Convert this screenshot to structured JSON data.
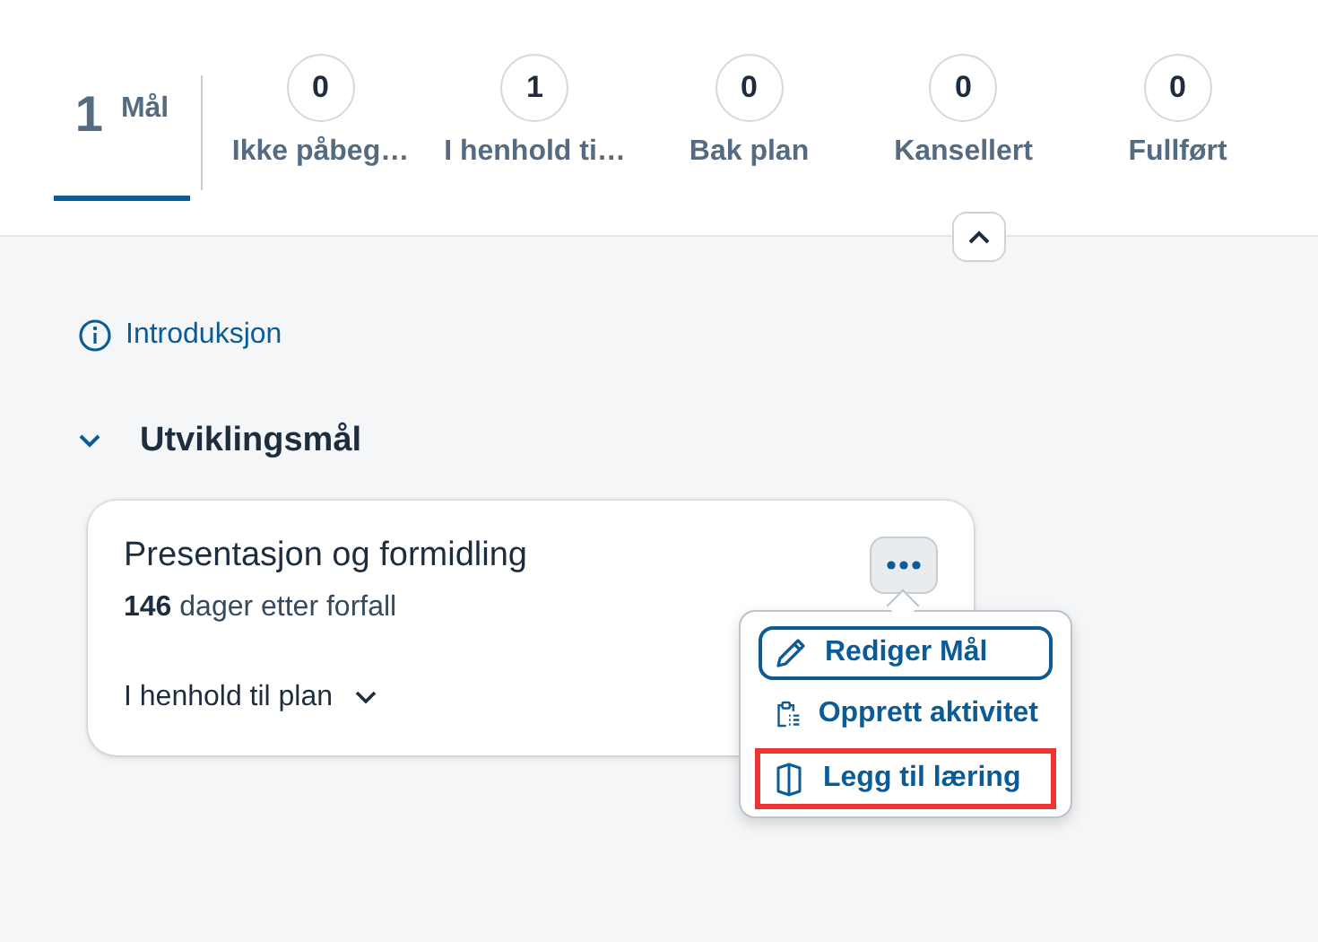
{
  "tabs": [
    {
      "kind": "total",
      "count": "1",
      "label": "Mål",
      "selected": true
    },
    {
      "kind": "status",
      "count": "0",
      "label": "Ikke påbeg…",
      "selected": false
    },
    {
      "kind": "status",
      "count": "1",
      "label": "I henhold ti…",
      "selected": false
    },
    {
      "kind": "status",
      "count": "0",
      "label": "Bak plan",
      "selected": false
    },
    {
      "kind": "status",
      "count": "0",
      "label": "Kansellert",
      "selected": false
    },
    {
      "kind": "status",
      "count": "0",
      "label": "Fullført",
      "selected": false
    }
  ],
  "header_expanded": true,
  "intro_link": "Introduksjon",
  "section": {
    "title": "Utviklingsmål",
    "expanded": true
  },
  "card": {
    "title": "Presentasjon og formidling",
    "due": "**146** dager etter forfall",
    "status": "I henhold til plan"
  },
  "menu": {
    "open": true,
    "items": [
      {
        "label": "Rediger Mål",
        "focused": true,
        "highlighted": false
      },
      {
        "label": "Opprett aktivitet",
        "focused": false,
        "highlighted": false
      },
      {
        "label": "Legg til læring",
        "focused": false,
        "highlighted": true
      }
    ]
  }
}
